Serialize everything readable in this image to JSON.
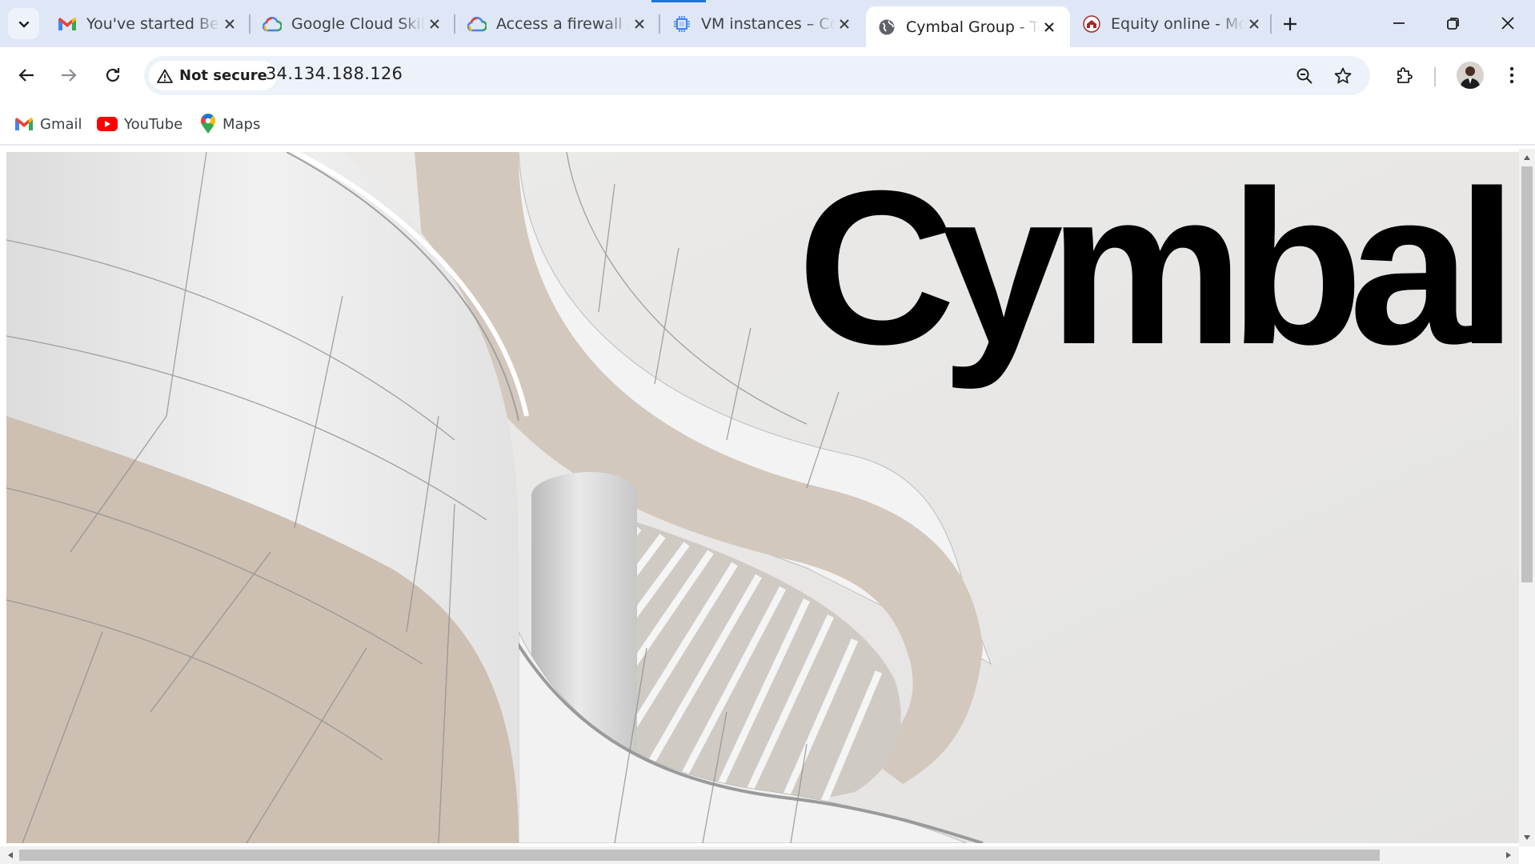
{
  "browser": {
    "tabs": [
      {
        "title": "You've started Beginner",
        "icon": "gmail-icon",
        "active": false
      },
      {
        "title": "Google Cloud Skills Boost",
        "icon": "google-cloud-icon",
        "active": false
      },
      {
        "title": "Access a firewall and",
        "icon": "google-cloud-icon",
        "active": false
      },
      {
        "title": "VM instances – Compute",
        "icon": "compute-engine-icon",
        "active": false
      },
      {
        "title": "Cymbal Group - Te",
        "icon": "globe-icon",
        "active": true
      },
      {
        "title": "Equity online - Mo",
        "icon": "equity-bank-icon",
        "active": false
      }
    ],
    "address_bar": {
      "security_label": "Not secure",
      "url": "34.134.188.126"
    },
    "bookmarks": [
      {
        "label": "Gmail",
        "icon": "gmail-icon"
      },
      {
        "label": "YouTube",
        "icon": "youtube-icon"
      },
      {
        "label": "Maps",
        "icon": "maps-pin-icon"
      }
    ]
  },
  "page": {
    "logo_text": "Cymbal"
  },
  "colors": {
    "tabstrip": "#dfe7f7",
    "omnibox": "#edf2fa",
    "accent": "#1a73e8"
  }
}
